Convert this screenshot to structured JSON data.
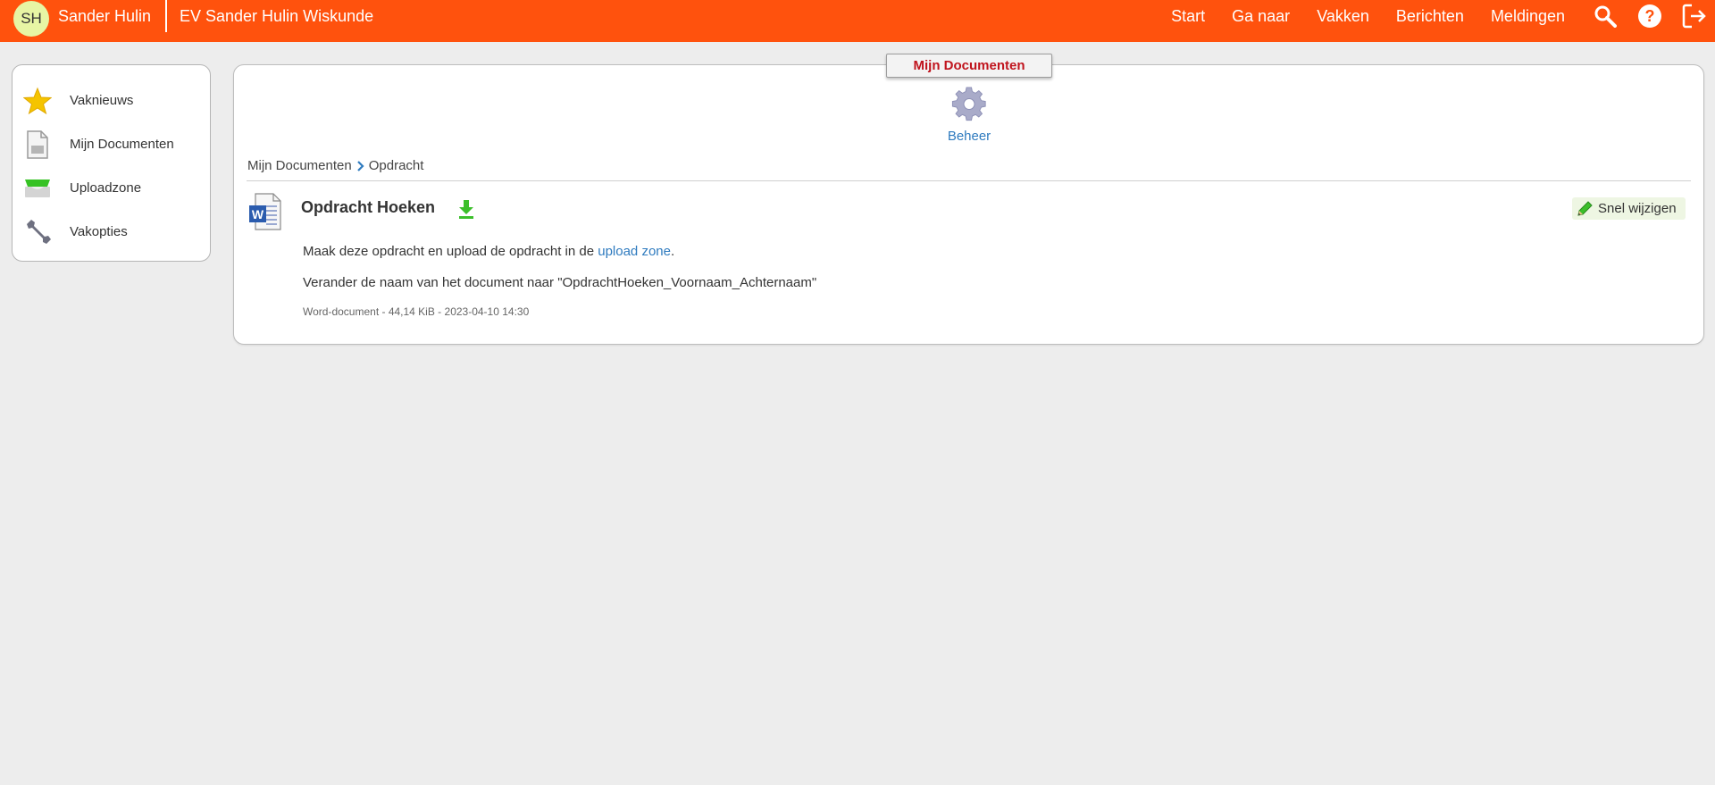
{
  "topbar": {
    "avatar_initials": "SH",
    "user_name": "Sander Hulin",
    "course_title": "EV Sander Hulin Wiskunde",
    "nav": [
      "Start",
      "Ga naar",
      "Vakken",
      "Berichten",
      "Meldingen"
    ],
    "icons": [
      "search-icon",
      "help-icon",
      "logout-icon"
    ],
    "background_color": "#ff520d"
  },
  "sidebar": {
    "items": [
      {
        "label": "Vaknieuws",
        "icon": "star-icon"
      },
      {
        "label": "Mijn Documenten",
        "icon": "document-icon"
      },
      {
        "label": "Uploadzone",
        "icon": "upload-tray-icon"
      },
      {
        "label": "Vakopties",
        "icon": "wrench-icon"
      }
    ]
  },
  "main": {
    "section_tab": "Mijn Documenten",
    "beheer_label": "Beheer",
    "breadcrumb": [
      "Mijn Documenten",
      "Opdracht"
    ],
    "document": {
      "title": "Opdracht Hoeken",
      "quick_edit_label": "Snel wijzigen",
      "description_prefix": "Maak deze opdracht en upload de opdracht in de ",
      "description_link": "upload zone",
      "description_suffix": ".",
      "description_2": "Verander de naam van het document naar \"OpdrachtHoeken_Voornaam_Achternaam\"",
      "meta": "Word-document - 44,14 KiB - 2023-04-10 14:30"
    }
  }
}
